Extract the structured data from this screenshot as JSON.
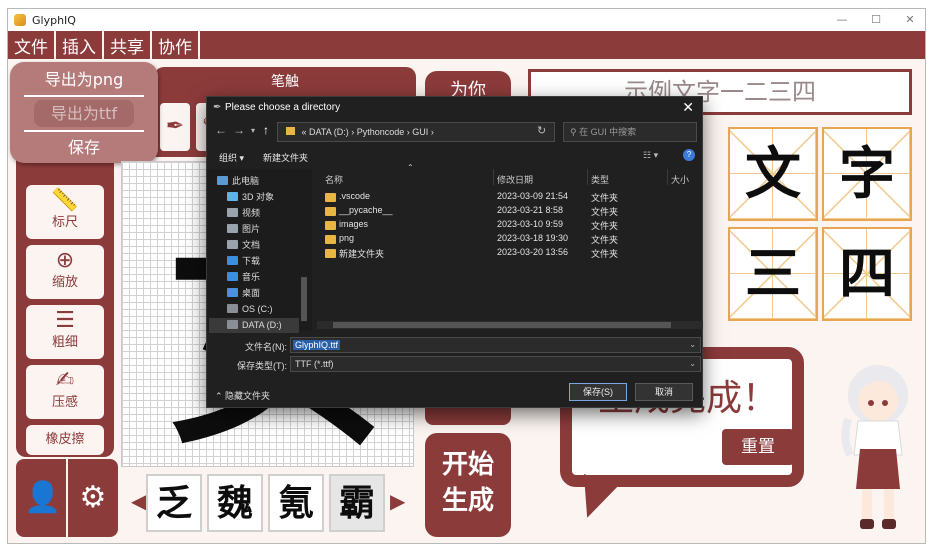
{
  "window": {
    "title": "GlyphIQ",
    "min": "—",
    "max": "☐",
    "close": "✕"
  },
  "menu": [
    "文件",
    "插入",
    "共享",
    "协作"
  ],
  "export_menu": {
    "png": "导出为png",
    "ttf": "导出为ttf",
    "save": "保存"
  },
  "pen_box": {
    "title": "笔触"
  },
  "tools": [
    {
      "label": "标尺",
      "icon": "ruler-icon"
    },
    {
      "label": "缩放",
      "icon": "zoom-icon"
    },
    {
      "label": "粗细",
      "icon": "thickness-icon"
    },
    {
      "label": "压感",
      "icon": "pressure-icon"
    },
    {
      "label": "橡皮擦",
      "icon": "eraser-icon"
    }
  ],
  "canvas": {
    "glyph": "女"
  },
  "candidates": [
    "乏",
    "魏",
    "氪",
    "霸"
  ],
  "predict_button": "为你",
  "generate_button": {
    "line1": "开始",
    "line2": "生成"
  },
  "sample_text": "示例文字一二三四",
  "preview_glyphs": [
    "文",
    "字",
    "三",
    "四"
  ],
  "result": {
    "message": "生成完成！",
    "reset": "重置"
  },
  "dialog": {
    "title": "Please choose a directory",
    "breadcrumb": [
      "DATA (D:)",
      "Pythoncode",
      "GUI"
    ],
    "search_placeholder": "在 GUI 中搜索",
    "toolbar": {
      "organize": "组织 ▾",
      "new_folder": "新建文件夹"
    },
    "sidebar": [
      {
        "label": "此电脑",
        "color": "#5b9bd5"
      },
      {
        "label": "3D 对象",
        "color": "#5fb3e6"
      },
      {
        "label": "视频",
        "color": "#9aa3ad"
      },
      {
        "label": "图片",
        "color": "#9aa3ad"
      },
      {
        "label": "文档",
        "color": "#9aa3ad"
      },
      {
        "label": "下载",
        "color": "#3d8ee0"
      },
      {
        "label": "音乐",
        "color": "#3d8ee0"
      },
      {
        "label": "桌面",
        "color": "#4a90e2"
      },
      {
        "label": "OS (C:)",
        "color": "#8a8f96"
      },
      {
        "label": "DATA (D:)",
        "color": "#8a8f96"
      }
    ],
    "columns": {
      "name": "名称",
      "modified": "修改日期",
      "type": "类型",
      "size": "大小"
    },
    "files": [
      {
        "name": ".vscode",
        "modified": "2023-03-09 21:54",
        "type": "文件夹"
      },
      {
        "name": "__pycache__",
        "modified": "2023-03-21 8:58",
        "type": "文件夹"
      },
      {
        "name": "images",
        "modified": "2023-03-10 9:59",
        "type": "文件夹"
      },
      {
        "name": "png",
        "modified": "2023-03-18 19:30",
        "type": "文件夹"
      },
      {
        "name": "新建文件夹",
        "modified": "2023-03-20 13:56",
        "type": "文件夹"
      }
    ],
    "filename_label": "文件名(N):",
    "filename_value": "GlyphIQ.ttf",
    "filetype_label": "保存类型(T):",
    "filetype_value": "TTF (*.ttf)",
    "hide_folders": "隐藏文件夹",
    "save": "保存(S)",
    "cancel": "取消"
  },
  "colors": {
    "brand": "#8c3b3b",
    "background": "#fbf4f1",
    "tile_border": "#e8a552"
  }
}
